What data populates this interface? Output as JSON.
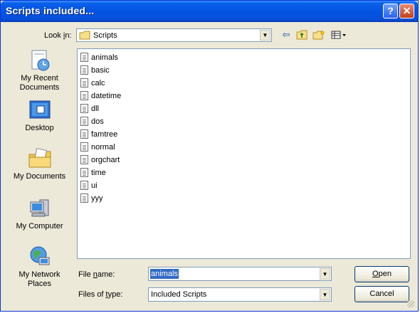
{
  "window": {
    "title": "Scripts included..."
  },
  "titlebar": {
    "help": "?",
    "close": "✕"
  },
  "lookin": {
    "label": "Look in:",
    "value": "Scripts"
  },
  "toolbar": {
    "back": "⇦",
    "up": "⇧",
    "new_folder": "✱",
    "views": "▦▾"
  },
  "places": [
    {
      "label": "My Recent Documents",
      "icon": "recent-documents-icon"
    },
    {
      "label": "Desktop",
      "icon": "desktop-icon"
    },
    {
      "label": "My Documents",
      "icon": "my-documents-icon"
    },
    {
      "label": "My Computer",
      "icon": "my-computer-icon"
    },
    {
      "label": "My Network Places",
      "icon": "network-places-icon"
    }
  ],
  "files": [
    "animals",
    "basic",
    "calc",
    "datetime",
    "dll",
    "dos",
    "famtree",
    "normal",
    "orgchart",
    "time",
    "ui",
    "yyy"
  ],
  "file_name": {
    "label": "File name:",
    "value": "animals"
  },
  "file_type": {
    "label": "Files of type:",
    "value": "Included Scripts"
  },
  "buttons": {
    "open": "Open",
    "cancel": "Cancel"
  }
}
